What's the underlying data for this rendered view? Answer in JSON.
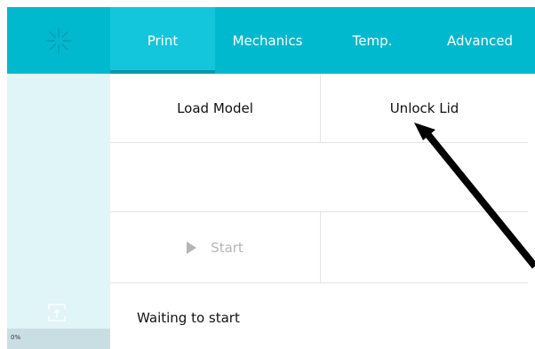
{
  "tabs": [
    {
      "label": "Print",
      "active": true
    },
    {
      "label": "Mechanics",
      "active": false
    },
    {
      "label": "Temp.",
      "active": false
    },
    {
      "label": "Advanced",
      "active": false
    }
  ],
  "actions": {
    "load_model": "Load Model",
    "unlock_lid": "Unlock Lid",
    "start": "Start"
  },
  "status_text": "Waiting to start",
  "progress": {
    "label": "0%",
    "value": 0
  },
  "icons": {
    "logo": "snowflake-logo-icon",
    "upload": "upload-icon",
    "play": "play-icon",
    "annotation": "arrow-icon"
  },
  "colors": {
    "accent": "#00b9cf",
    "sidebar_bg": "#dff5f8",
    "disabled_text": "#b5b5b5"
  }
}
